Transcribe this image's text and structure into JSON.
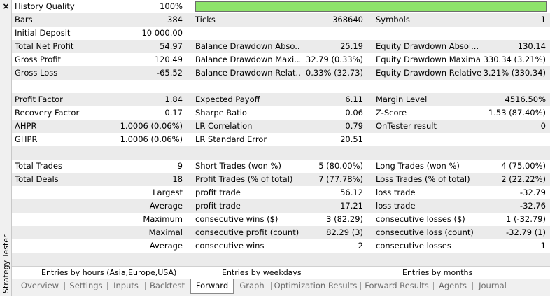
{
  "window": {
    "side_title": "Strategy Tester",
    "close_label": "×"
  },
  "rows": [
    {
      "l1": "History Quality",
      "v1": "100%",
      "l2": "",
      "v2": "",
      "l3": "",
      "v3": "",
      "bar": true
    },
    {
      "l1": "Bars",
      "v1": "384",
      "l2": "Ticks",
      "v2": "368640",
      "l3": "Symbols",
      "v3": "1"
    },
    {
      "l1": "Initial Deposit",
      "v1": "10 000.00",
      "l2": "",
      "v2": "",
      "l3": "",
      "v3": ""
    },
    {
      "l1": "Total Net Profit",
      "v1": "54.97",
      "l2": "Balance Drawdown Abso...",
      "v2": "25.19",
      "l3": "Equity Drawdown Absol...",
      "v3": "130.14"
    },
    {
      "l1": "Gross Profit",
      "v1": "120.49",
      "l2": "Balance Drawdown Maxi...",
      "v2": "32.79 (0.33%)",
      "l3": "Equity Drawdown Maximal",
      "v3": "330.34 (3.21%)"
    },
    {
      "l1": "Gross Loss",
      "v1": "-65.52",
      "l2": "Balance Drawdown Relat...",
      "v2": "0.33% (32.73)",
      "l3": "Equity Drawdown Relative",
      "v3": "3.21% (330.34)"
    },
    {
      "l1": "",
      "v1": "",
      "l2": "",
      "v2": "",
      "l3": "",
      "v3": ""
    },
    {
      "l1": "Profit Factor",
      "v1": "1.84",
      "l2": "Expected Payoff",
      "v2": "6.11",
      "l3": "Margin Level",
      "v3": "4516.50%"
    },
    {
      "l1": "Recovery Factor",
      "v1": "0.17",
      "l2": "Sharpe Ratio",
      "v2": "0.06",
      "l3": "Z-Score",
      "v3": "1.53 (87.40%)"
    },
    {
      "l1": "AHPR",
      "v1": "1.0006 (0.06%)",
      "l2": "LR Correlation",
      "v2": "0.79",
      "l3": "OnTester result",
      "v3": "0"
    },
    {
      "l1": "GHPR",
      "v1": "1.0006 (0.06%)",
      "l2": "LR Standard Error",
      "v2": "20.51",
      "l3": "",
      "v3": ""
    },
    {
      "l1": "",
      "v1": "",
      "l2": "",
      "v2": "",
      "l3": "",
      "v3": ""
    },
    {
      "l1": "Total Trades",
      "v1": "9",
      "l2": "Short Trades (won %)",
      "v2": "5 (80.00%)",
      "l3": "Long Trades (won %)",
      "v3": "4 (75.00%)"
    },
    {
      "l1": "Total Deals",
      "v1": "18",
      "l2": "Profit Trades (% of total)",
      "v2": "7 (77.78%)",
      "l3": "Loss Trades (% of total)",
      "v3": "2 (22.22%)"
    },
    {
      "l1": "",
      "v1": "Largest",
      "l2": "profit trade",
      "v2": "56.12",
      "l3": "loss trade",
      "v3": "-32.79"
    },
    {
      "l1": "",
      "v1": "Average",
      "l2": "profit trade",
      "v2": "17.21",
      "l3": "loss trade",
      "v3": "-32.76"
    },
    {
      "l1": "",
      "v1": "Maximum",
      "l2": "consecutive wins ($)",
      "v2": "3 (82.29)",
      "l3": "consecutive losses ($)",
      "v3": "1 (-32.79)"
    },
    {
      "l1": "",
      "v1": "Maximal",
      "l2": "consecutive profit (count)",
      "v2": "82.29 (3)",
      "l3": "consecutive loss (count)",
      "v3": "-32.79 (1)"
    },
    {
      "l1": "",
      "v1": "Average",
      "l2": "consecutive wins",
      "v2": "2",
      "l3": "consecutive losses",
      "v3": "1"
    },
    {
      "l1": "",
      "v1": "",
      "l2": "",
      "v2": "",
      "l3": "",
      "v3": ""
    }
  ],
  "entries": [
    "Entries by hours (Asia,Europe,USA)",
    "Entries by weekdays",
    "Entries by months"
  ],
  "tabs": [
    "Overview",
    "Settings",
    "Inputs",
    "Backtest",
    "Forward",
    "Graph",
    "Optimization Results",
    "Forward Results",
    "Agents",
    "Journal"
  ],
  "active_tab": "Forward",
  "colors": {
    "quality_bar": "#8ee36b",
    "alt_row": "#ebebeb"
  }
}
